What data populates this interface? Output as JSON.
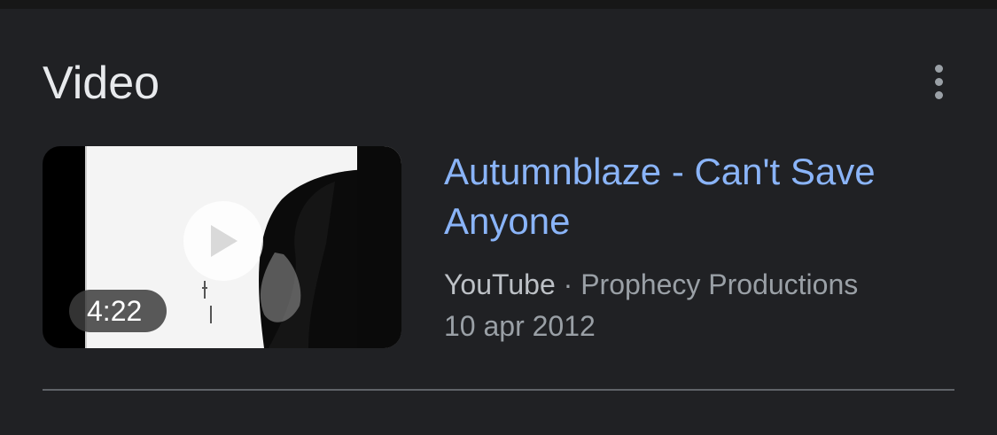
{
  "section": {
    "title": "Video",
    "more_icon": "more-vert-icon"
  },
  "video": {
    "title": "Autumnblaze - Can't Save Anyone",
    "duration": "4:22",
    "source": "YouTube",
    "separator": "·",
    "channel": "Prophecy Productions",
    "date": "10 apr 2012",
    "play_icon": "play-icon"
  },
  "colors": {
    "background": "#202124",
    "title_link": "#8ab4f8",
    "primary_text": "#e8eaed",
    "secondary_text": "#9aa0a6"
  }
}
